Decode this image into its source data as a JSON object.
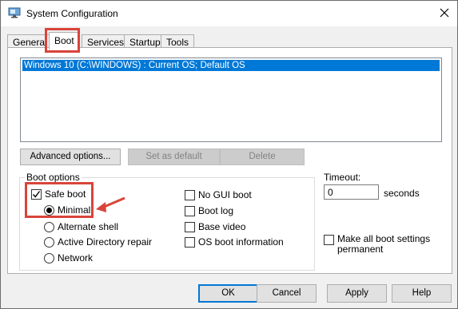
{
  "window": {
    "title": "System Configuration",
    "app_icon": "monitor-icon",
    "close_icon": "close-icon"
  },
  "tabs": [
    {
      "label": "General",
      "active": false
    },
    {
      "label": "Boot",
      "active": true
    },
    {
      "label": "Services",
      "active": false
    },
    {
      "label": "Startup",
      "active": false
    },
    {
      "label": "Tools",
      "active": false
    }
  ],
  "os_list": {
    "items": [
      "Windows 10 (C:\\WINDOWS) : Current OS; Default OS"
    ],
    "selected_index": 0
  },
  "buttons": {
    "advanced": "Advanced options...",
    "set_default": "Set as default",
    "delete": "Delete"
  },
  "boot_options": {
    "legend": "Boot options",
    "safe_boot": {
      "label": "Safe boot",
      "checked": true
    },
    "minimal": {
      "label": "Minimal",
      "selected": true
    },
    "alternate_shell": {
      "label": "Alternate shell",
      "selected": false
    },
    "active_directory": {
      "label": "Active Directory repair",
      "selected": false
    },
    "network": {
      "label": "Network",
      "selected": false
    },
    "no_gui": {
      "label": "No GUI boot",
      "checked": false
    },
    "boot_log": {
      "label": "Boot log",
      "checked": false
    },
    "base_video": {
      "label": "Base video",
      "checked": false
    },
    "os_boot_info": {
      "label": "OS boot information",
      "checked": false
    }
  },
  "timeout": {
    "label": "Timeout:",
    "value": "0",
    "unit": "seconds"
  },
  "make_permanent": {
    "label_line1": "Make all boot settings",
    "label_line2": "permanent",
    "checked": false
  },
  "footer": {
    "ok": "OK",
    "cancel": "Cancel",
    "apply": "Apply",
    "help": "Help"
  },
  "annotation_color": "#d9443a",
  "selection_color": "#0078d7"
}
